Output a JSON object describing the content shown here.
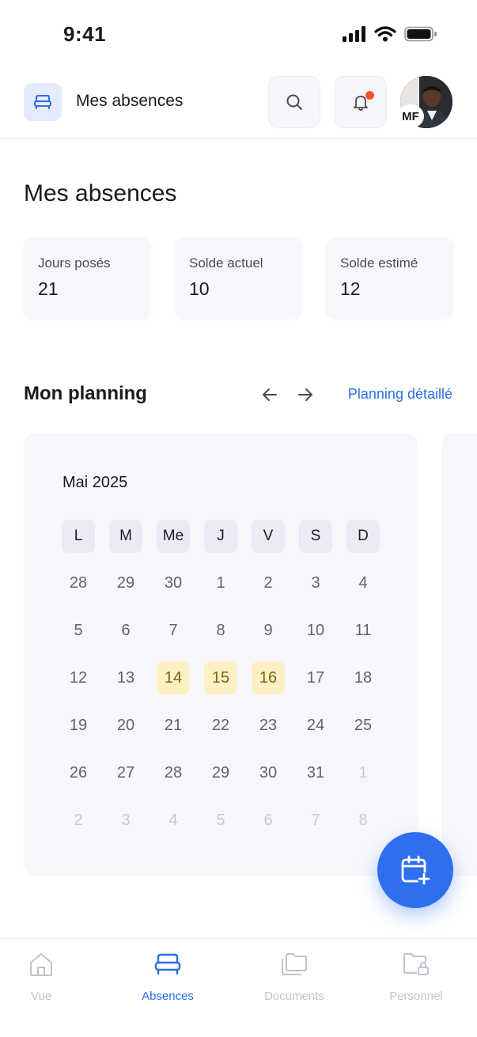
{
  "status_bar": {
    "time": "9:41"
  },
  "header": {
    "title": "Mes absences",
    "avatar_initials": "MF"
  },
  "page": {
    "title": "Mes absences"
  },
  "stats": [
    {
      "label": "Jours posés",
      "value": "21"
    },
    {
      "label": "Solde actuel",
      "value": "10"
    },
    {
      "label": "Solde estimé",
      "value": "12"
    }
  ],
  "planning": {
    "title": "Mon planning",
    "link_label": "Planning détaillé",
    "month": "Mai 2025",
    "weekdays": [
      "L",
      "M",
      "Me",
      "J",
      "V",
      "S",
      "D"
    ],
    "weeks": [
      [
        "28",
        "29",
        "30",
        "1",
        "2",
        "3",
        "4"
      ],
      [
        "5",
        "6",
        "7",
        "8",
        "9",
        "10",
        "11"
      ],
      [
        "12",
        "13",
        "14",
        "15",
        "16",
        "17",
        "18"
      ],
      [
        "19",
        "20",
        "21",
        "22",
        "23",
        "24",
        "25"
      ],
      [
        "26",
        "27",
        "28",
        "29",
        "30",
        "31",
        "1"
      ],
      [
        "2",
        "3",
        "4",
        "5",
        "6",
        "7",
        "8"
      ]
    ],
    "highlighted_days": [
      "14",
      "15",
      "16"
    ]
  },
  "bottom_nav": [
    {
      "label": "Vue",
      "icon": "home-icon",
      "active": false
    },
    {
      "label": "Absences",
      "icon": "bed-icon",
      "active": true
    },
    {
      "label": "Documents",
      "icon": "folders-icon",
      "active": false
    },
    {
      "label": "Personnel",
      "icon": "folder-lock-icon",
      "active": false
    }
  ],
  "colors": {
    "accent": "#2a6ee8",
    "fab": "#2f6fef",
    "highlight": "#fdf1c4",
    "notification": "#f2542d"
  }
}
